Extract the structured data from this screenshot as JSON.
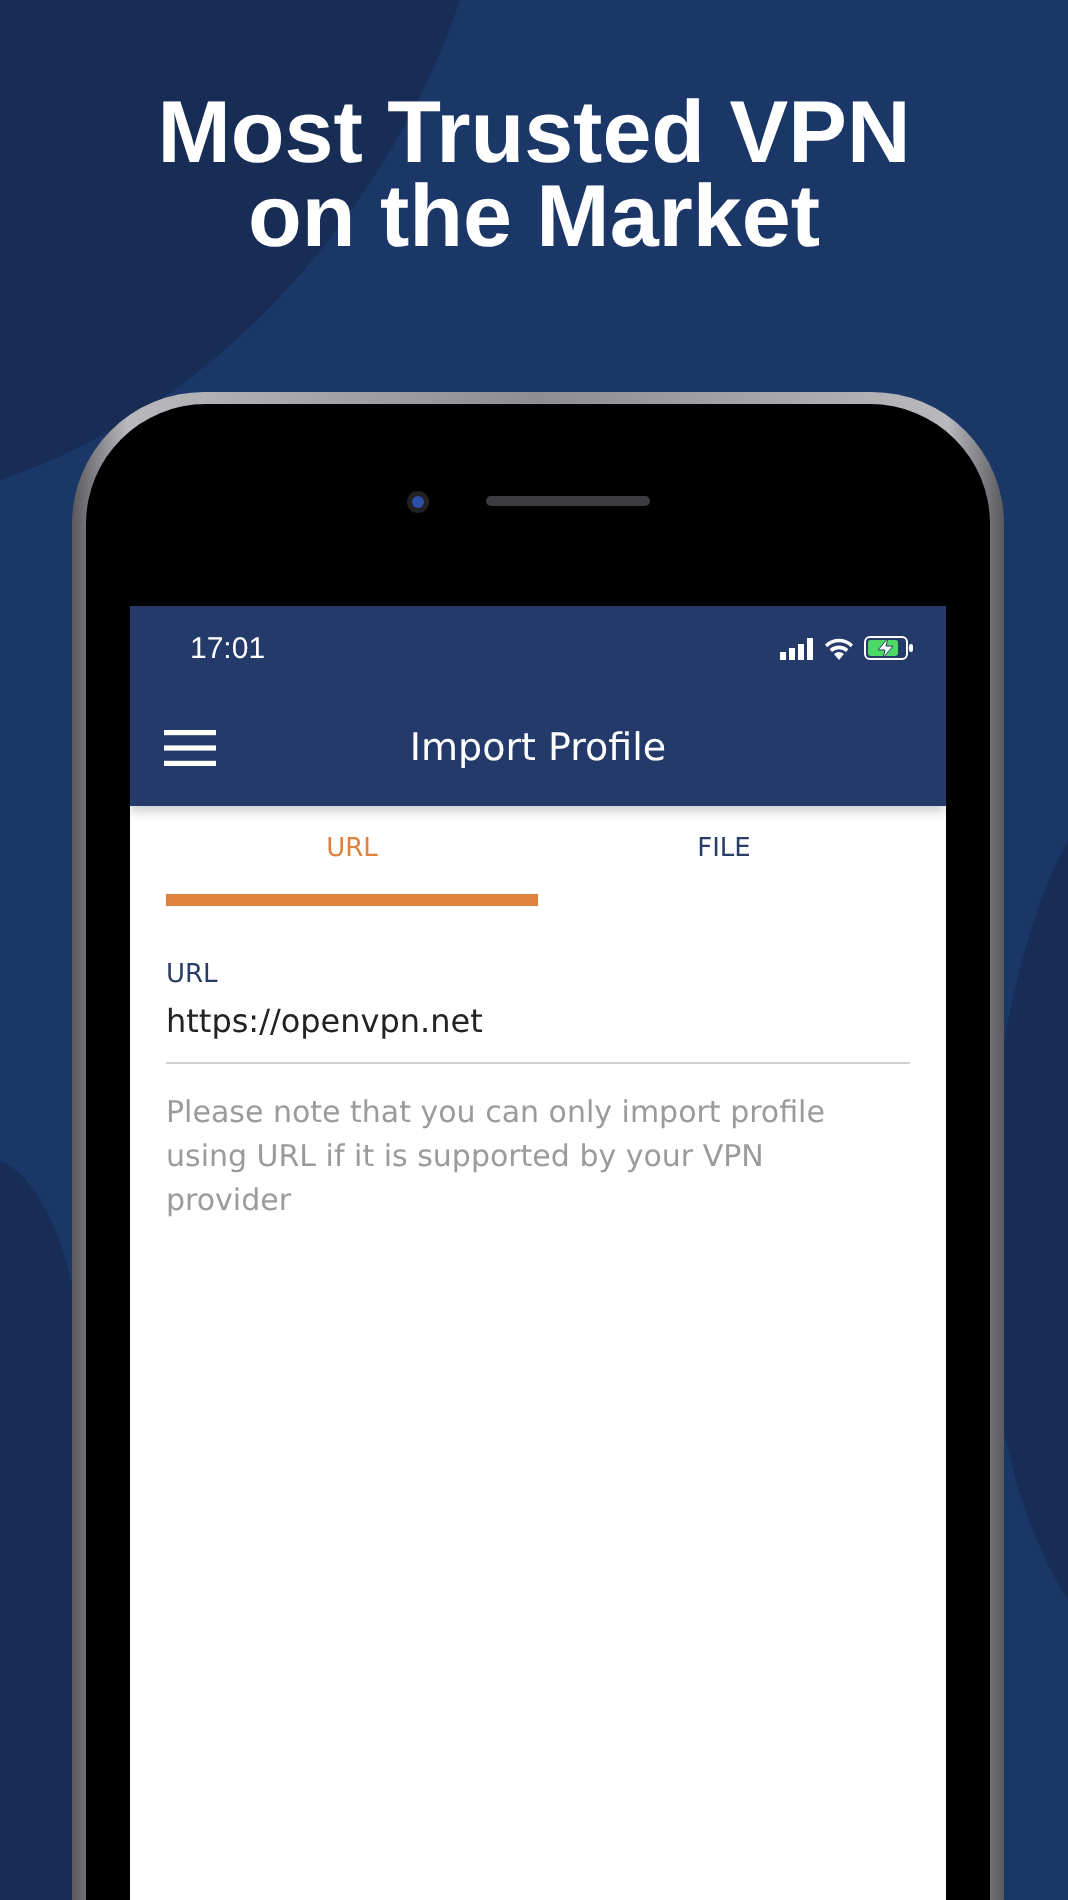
{
  "headline": "Most Trusted VPN\non the Market",
  "status_bar": {
    "time": "17:01"
  },
  "app_bar": {
    "title": "Import Profile"
  },
  "tabs": [
    {
      "label": "URL",
      "selected": true
    },
    {
      "label": "FILE",
      "selected": false
    }
  ],
  "url_field": {
    "label": "URL",
    "value": "https://openvpn.net"
  },
  "note": "Please note that you can only import profile using URL if it is supported by your VPN provider"
}
